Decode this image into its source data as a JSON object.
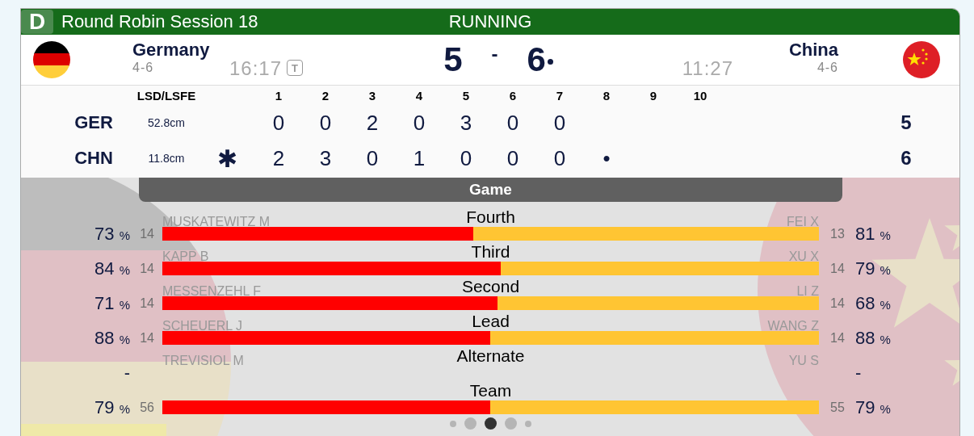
{
  "header": {
    "badge": "D",
    "title": "Round Robin Session 18",
    "status": "RUNNING"
  },
  "teams": [
    {
      "name": "Germany",
      "record": "4-6",
      "time": "16:17",
      "timeout_badge": "T",
      "score": "5",
      "hammer": false
    },
    {
      "name": "China",
      "record": "4-6",
      "time": "11:27",
      "score": "6",
      "hammer": true
    }
  ],
  "score_separator": "-",
  "linescore": {
    "lsd_heading": "LSD/LSFE",
    "ends": [
      "1",
      "2",
      "3",
      "4",
      "5",
      "6",
      "7",
      "8",
      "9",
      "10"
    ],
    "rows": [
      {
        "code": "GER",
        "lsd": "52.8cm",
        "ends": [
          "0",
          "0",
          "2",
          "0",
          "3",
          "0",
          "0"
        ],
        "total": "5"
      },
      {
        "code": "CHN",
        "lsd": "11.8cm",
        "hammer_mark": "✱",
        "ends": [
          "2",
          "3",
          "0",
          "1",
          "0",
          "0",
          "0",
          "•"
        ],
        "total": "6"
      }
    ]
  },
  "game": {
    "heading": "Game",
    "rows": [
      {
        "position": "Fourth",
        "left_player": "MUSKATEWITZ M",
        "left_count": "14",
        "left_pct": "73",
        "right_player": "FEI X",
        "right_count": "13",
        "right_pct": "81",
        "level": 0.474
      },
      {
        "position": "Third",
        "left_player": "KAPP B",
        "left_count": "14",
        "left_pct": "84",
        "right_player": "XU X",
        "right_count": "14",
        "right_pct": "79",
        "level": 0.515
      },
      {
        "position": "Second",
        "left_player": "MESSENZEHL F",
        "left_count": "14",
        "left_pct": "71",
        "right_player": "LI Z",
        "right_count": "14",
        "right_pct": "68",
        "level": 0.51
      },
      {
        "position": "Lead",
        "left_player": "SCHEUERL J",
        "left_count": "14",
        "left_pct": "88",
        "right_player": "WANG Z",
        "right_count": "14",
        "right_pct": "88",
        "level": 0.499
      },
      {
        "position": "Alternate",
        "left_player": "TREVISIOL M",
        "left_pct": "-",
        "right_player": "YU S",
        "right_pct": "-"
      },
      {
        "position": "Team",
        "left_count": "56",
        "left_pct": "79",
        "right_count": "55",
        "right_pct": "79",
        "level": 0.499
      }
    ],
    "pct_sign": "%"
  },
  "pager": [
    {
      "selected": false
    },
    {
      "selected": false
    },
    {
      "selected": true
    },
    {
      "selected": false
    },
    {
      "selected": false
    }
  ]
}
